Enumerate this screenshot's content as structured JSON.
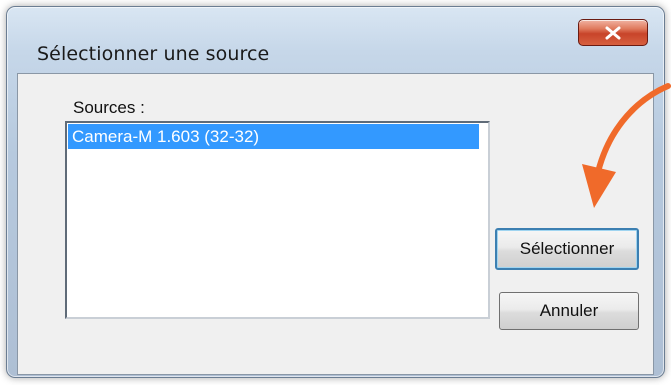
{
  "window": {
    "title": "Sélectionner une source",
    "close_icon": "close-icon"
  },
  "sources": {
    "label": "Sources :",
    "items": [
      {
        "label": "Camera-M 1.603 (32-32)",
        "selected": true
      }
    ]
  },
  "buttons": {
    "select_label": "Sélectionner",
    "cancel_label": "Annuler"
  },
  "colors": {
    "selection": "#3399ff",
    "annotation_arrow": "#f06a2a",
    "close_button": "#c8442a"
  }
}
